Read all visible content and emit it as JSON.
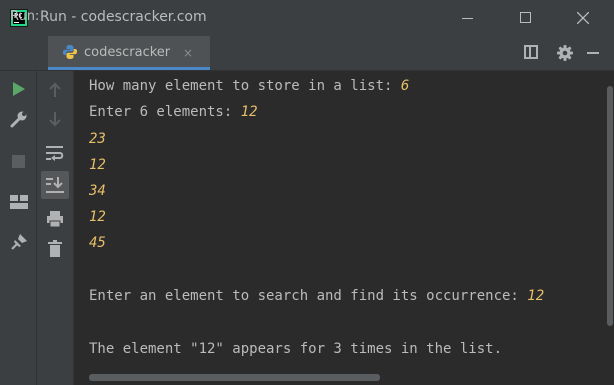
{
  "window": {
    "title": "Run - codescracker.com"
  },
  "toolwindow": {
    "run_label": "Run:",
    "tab_label": "codescracker",
    "tab_close": "×"
  },
  "icons": {
    "app": "pycharm-logo-icon",
    "tab": "python-icon",
    "left_bar_1": [
      "rerun-icon",
      "wrench-icon",
      "stop-icon",
      "layout-icon",
      "pin-icon"
    ],
    "left_bar_2": [
      "up-arrow-icon",
      "down-arrow-icon",
      "soft-wrap-icon",
      "scroll-to-end-icon",
      "print-icon",
      "trash-icon"
    ],
    "right": [
      "layout-icon",
      "gear-icon",
      "minimize-icon"
    ]
  },
  "colors": {
    "background": "#2b2b2b",
    "chrome": "#3c3f41",
    "text": "#bbbbbb",
    "user_input": "#e8bf6a",
    "run_green": "#59a869",
    "tab_accent": "#4a88c7"
  },
  "console": {
    "lines": [
      {
        "prompt": "How many element to store in a list: ",
        "input": "6"
      },
      {
        "prompt": "Enter 6 elements: ",
        "input": "12"
      },
      {
        "prompt": "",
        "input": "23"
      },
      {
        "prompt": "",
        "input": "12"
      },
      {
        "prompt": "",
        "input": "34"
      },
      {
        "prompt": "",
        "input": "12"
      },
      {
        "prompt": "",
        "input": "45"
      },
      {
        "prompt": "Enter an element to search and find its occurrence: ",
        "input": "12"
      },
      {
        "prompt": "The element \"12\" appears for 3 times in the list.",
        "input": ""
      }
    ]
  }
}
